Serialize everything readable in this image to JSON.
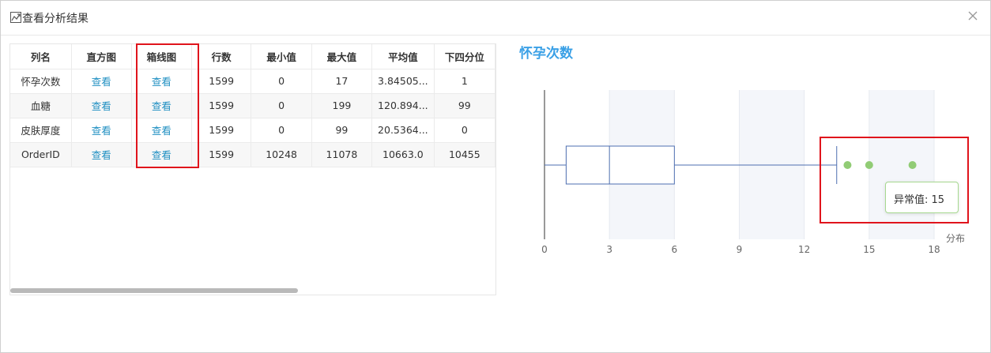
{
  "dialog": {
    "title": "查看分析结果",
    "icon": "chart-analysis-icon",
    "close_icon": "close-icon"
  },
  "table": {
    "headers": [
      "列名",
      "直方图",
      "箱线图",
      "行数",
      "最小值",
      "最大值",
      "平均值",
      "下四分位"
    ],
    "view_label": "查看",
    "rows": [
      {
        "name": "怀孕次数",
        "hist": "查看",
        "box": "查看",
        "rows": "1599",
        "min": "0",
        "max": "17",
        "avg": "3.84505...",
        "q1": "1"
      },
      {
        "name": "血糖",
        "hist": "查看",
        "box": "查看",
        "rows": "1599",
        "min": "0",
        "max": "199",
        "avg": "120.894...",
        "q1": "99"
      },
      {
        "name": "皮肤厚度",
        "hist": "查看",
        "box": "查看",
        "rows": "1599",
        "min": "0",
        "max": "99",
        "avg": "20.5364...",
        "q1": "0"
      },
      {
        "name": "OrderID",
        "hist": "查看",
        "box": "查看",
        "rows": "1599",
        "min": "10248",
        "max": "11078",
        "avg": "10663.0",
        "q1": "10455"
      }
    ]
  },
  "chart_data": {
    "type": "boxplot",
    "title": "怀孕次数",
    "xlabel": "分布",
    "xlim": [
      0,
      18
    ],
    "x_ticks": [
      0,
      3,
      6,
      9,
      12,
      15,
      18
    ],
    "box": {
      "whisker_low": 0,
      "q1": 1,
      "median": 3,
      "q3": 6,
      "whisker_high": 13.5
    },
    "outliers": [
      14,
      15,
      17
    ],
    "colors": {
      "box": "#4e6fb0",
      "outlier": "#91cc75",
      "band": "#f4f6fa"
    }
  },
  "tooltip": {
    "label": "异常值:",
    "value": "15"
  },
  "highlight_color": "#e0141c"
}
